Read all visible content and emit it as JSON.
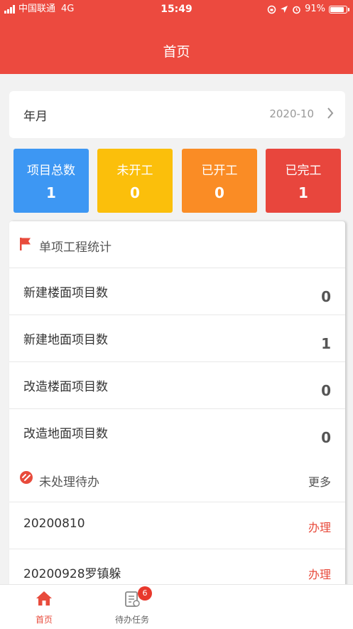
{
  "status_bar": {
    "carrier": "中国联通",
    "network": "4G",
    "time": "15:49",
    "battery_percent": "91%",
    "battery_level": 0.91
  },
  "header": {
    "title": "首页"
  },
  "month_selector": {
    "label": "年月",
    "value": "2020-10"
  },
  "stats": [
    {
      "label": "项目总数",
      "value": "1",
      "color": "#3d97f3"
    },
    {
      "label": "未开工",
      "value": "0",
      "color": "#fbbf0b"
    },
    {
      "label": "已开工",
      "value": "0",
      "color": "#fa8c25"
    },
    {
      "label": "已完工",
      "value": "1",
      "color": "#e8463d"
    }
  ],
  "single_project_stats": {
    "title": "单项工程统计",
    "items": [
      {
        "label": "新建楼面项目数",
        "value": "0"
      },
      {
        "label": "新建地面项目数",
        "value": "1"
      },
      {
        "label": "改造楼面项目数",
        "value": "0"
      },
      {
        "label": "改造地面项目数",
        "value": "0"
      }
    ]
  },
  "pending": {
    "title": "未处理待办",
    "more_label": "更多",
    "items": [
      {
        "label": "20200810",
        "action": "办理"
      },
      {
        "label": "20200928罗镇躲",
        "action": "办理"
      }
    ]
  },
  "tabbar": {
    "tabs": [
      {
        "label": "首页",
        "icon": "home-icon"
      },
      {
        "label": "待办任务",
        "icon": "task-list-icon",
        "badge": "6"
      }
    ]
  },
  "colors": {
    "brand": "#ec4a3f",
    "action": "#e84b3c"
  }
}
